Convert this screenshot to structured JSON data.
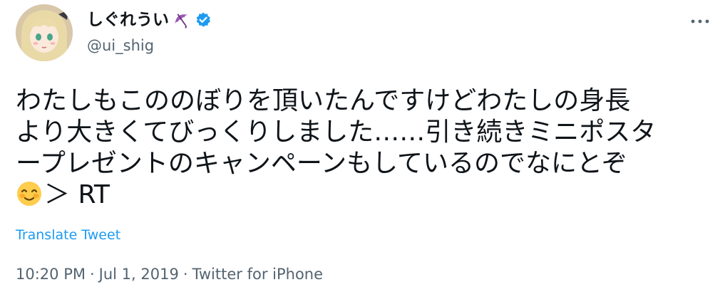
{
  "author": {
    "display_name": "しぐれうい",
    "handle": "@ui_shig",
    "name_emoji_icon": "umbrella-icon",
    "verified_icon": "verified-badge-icon",
    "verified_color": "#1d9bf0"
  },
  "tweet": {
    "lines": [
      "わたしもこののぼりを頂いたんですけどわたしの身長",
      "より大きくてびっくりしました……引き続きミニポスタ",
      "ープレゼントのキャンペーンもしているのでなにとぞ",
      "＞ RT"
    ],
    "emoji_icon": "smiling-face-with-rosy-cheeks-icon",
    "translate_label": "Translate Tweet"
  },
  "meta": {
    "time": "10:20 PM",
    "separator": "·",
    "date": "Jul 1, 2019",
    "source": "Twitter for iPhone"
  },
  "colors": {
    "text": "#0f1419",
    "secondary": "#536471",
    "link": "#1d9bf0"
  }
}
